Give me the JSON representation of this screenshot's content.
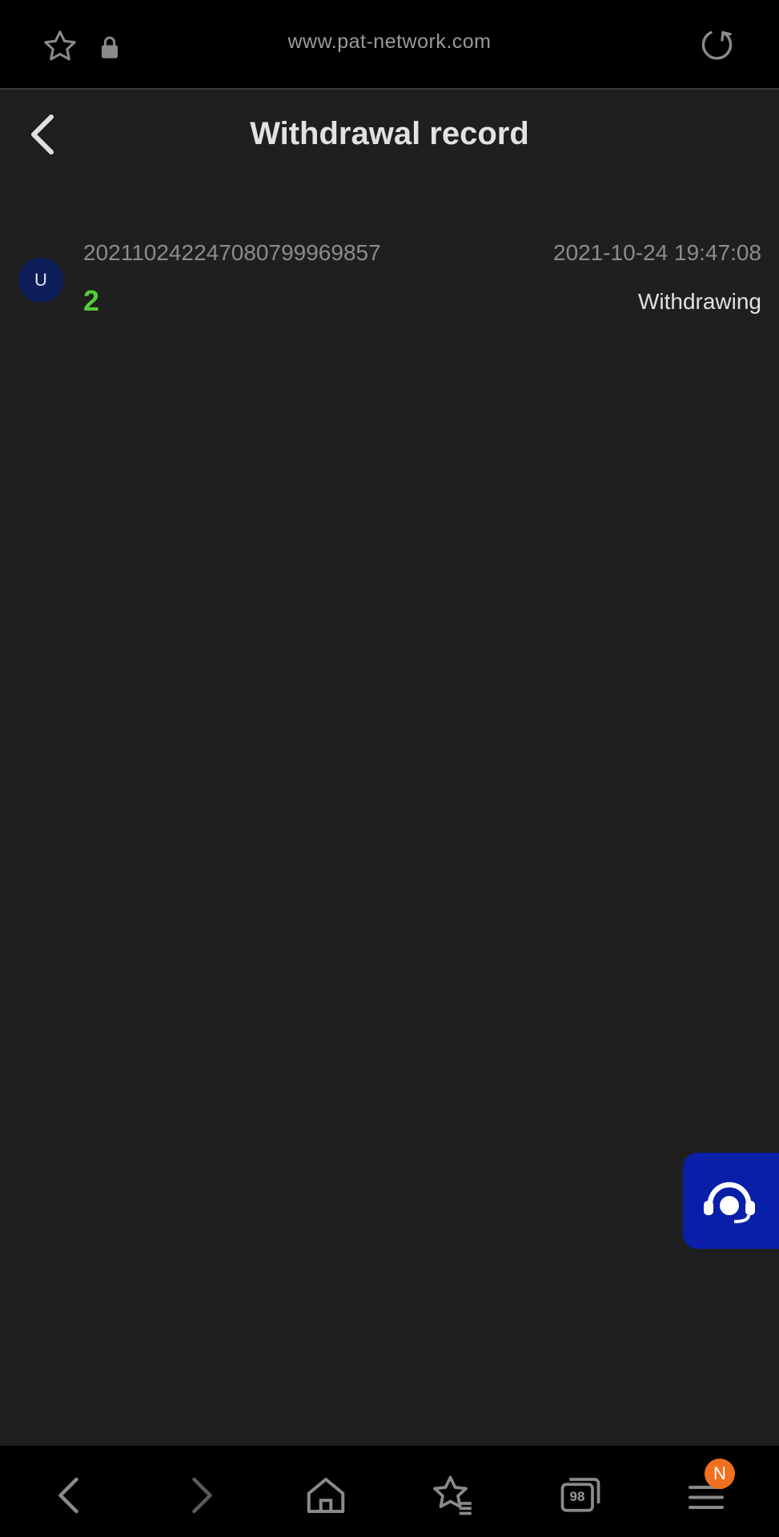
{
  "browser": {
    "url": "www.pat-network.com",
    "icons": {
      "bookmark": "star-icon",
      "secure": "lock-icon",
      "reload": "reload-icon"
    },
    "bottom_nav": {
      "back": "back-icon",
      "forward": "forward-icon",
      "home": "home-icon",
      "bookmarks": "bookmarks-icon",
      "tabs_count": "98",
      "menu": "menu-icon",
      "menu_badge": "N"
    }
  },
  "header": {
    "title": "Withdrawal record",
    "back": "chevron-left-icon"
  },
  "records": [
    {
      "avatar": "U",
      "order_id": "202110242247080799969857",
      "time": "2021-10-24 19:47:08",
      "amount": "2",
      "status": "Withdrawing"
    }
  ],
  "support": {
    "icon": "headset-icon"
  },
  "colors": {
    "background": "#1f1f1f",
    "amount": "#55cc3a",
    "support_button": "#0a1fa8",
    "badge": "#f0701e",
    "avatar": "#0e1e5a"
  }
}
